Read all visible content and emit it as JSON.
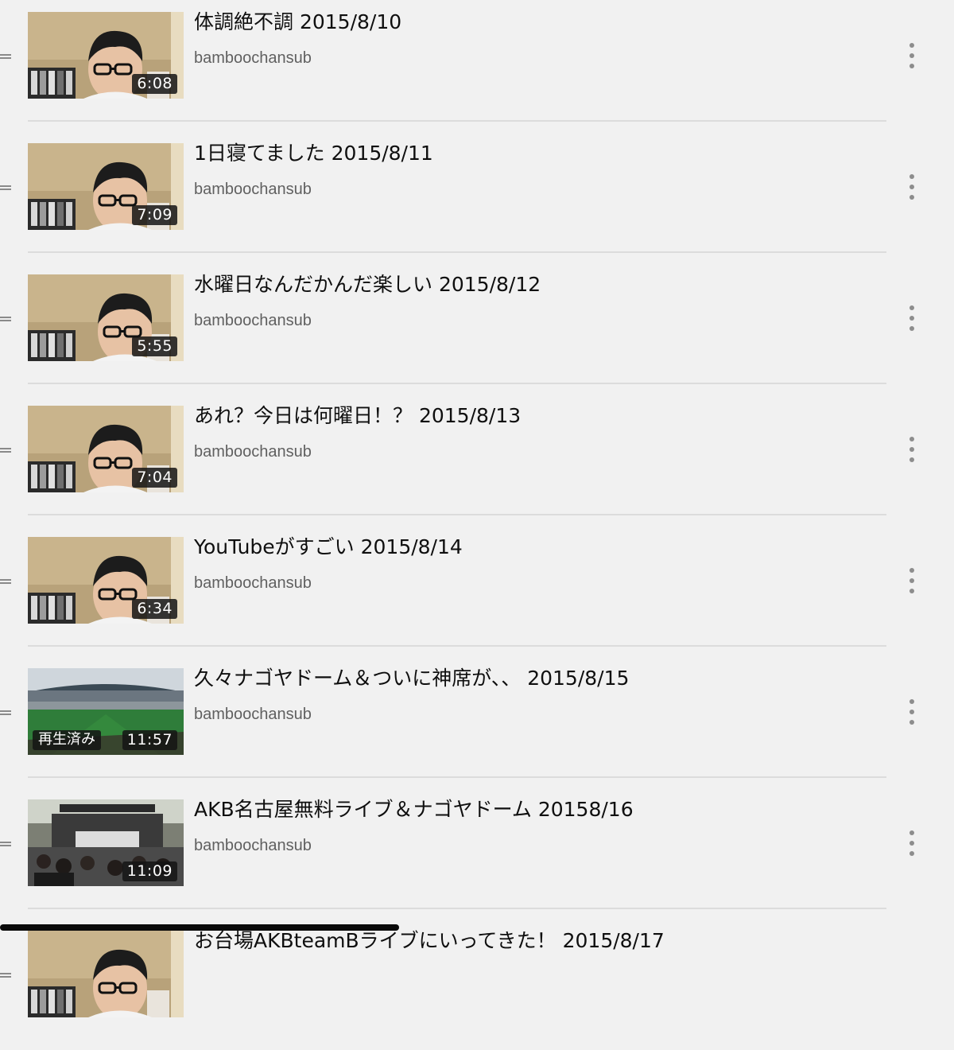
{
  "playlist": {
    "items": [
      {
        "title": "体調絶不調 2015/8/10",
        "channel": "bamboochansub",
        "duration": "6:08",
        "watched": "",
        "thumb": "room"
      },
      {
        "title": "1日寝てました 2015/8/11",
        "channel": "bamboochansub",
        "duration": "7:09",
        "watched": "",
        "thumb": "room"
      },
      {
        "title": "水曜日なんだかんだ楽しい 2015/8/12",
        "channel": "bamboochansub",
        "duration": "5:55",
        "watched": "",
        "thumb": "room"
      },
      {
        "title": "あれ？今日は何曜日！？ 2015/8/13",
        "channel": "bamboochansub",
        "duration": "7:04",
        "watched": "",
        "thumb": "room"
      },
      {
        "title": "YouTubeがすごい 2015/8/14",
        "channel": "bamboochansub",
        "duration": "6:34",
        "watched": "",
        "thumb": "room"
      },
      {
        "title": "久々ナゴヤドーム＆ついに神席が、、 2015/8/15",
        "channel": "bamboochansub",
        "duration": "11:57",
        "watched": "再生済み",
        "thumb": "stadium"
      },
      {
        "title": "AKB名古屋無料ライブ＆ナゴヤドーム 20158/16",
        "channel": "bamboochansub",
        "duration": "11:09",
        "watched": "",
        "thumb": "concert"
      },
      {
        "title": "お台場AKBteamBライブにいってきた！ 2015/8/17",
        "channel": "",
        "duration": "",
        "watched": "",
        "thumb": "room"
      }
    ]
  },
  "icons": {
    "drag": "drag-handle-icon",
    "more": "more-vert-icon"
  },
  "colors": {
    "background": "#f1f1f1",
    "title": "#0f0f0f",
    "channel": "#606060",
    "divider": "#dcdcdc",
    "badge": "#141414"
  }
}
